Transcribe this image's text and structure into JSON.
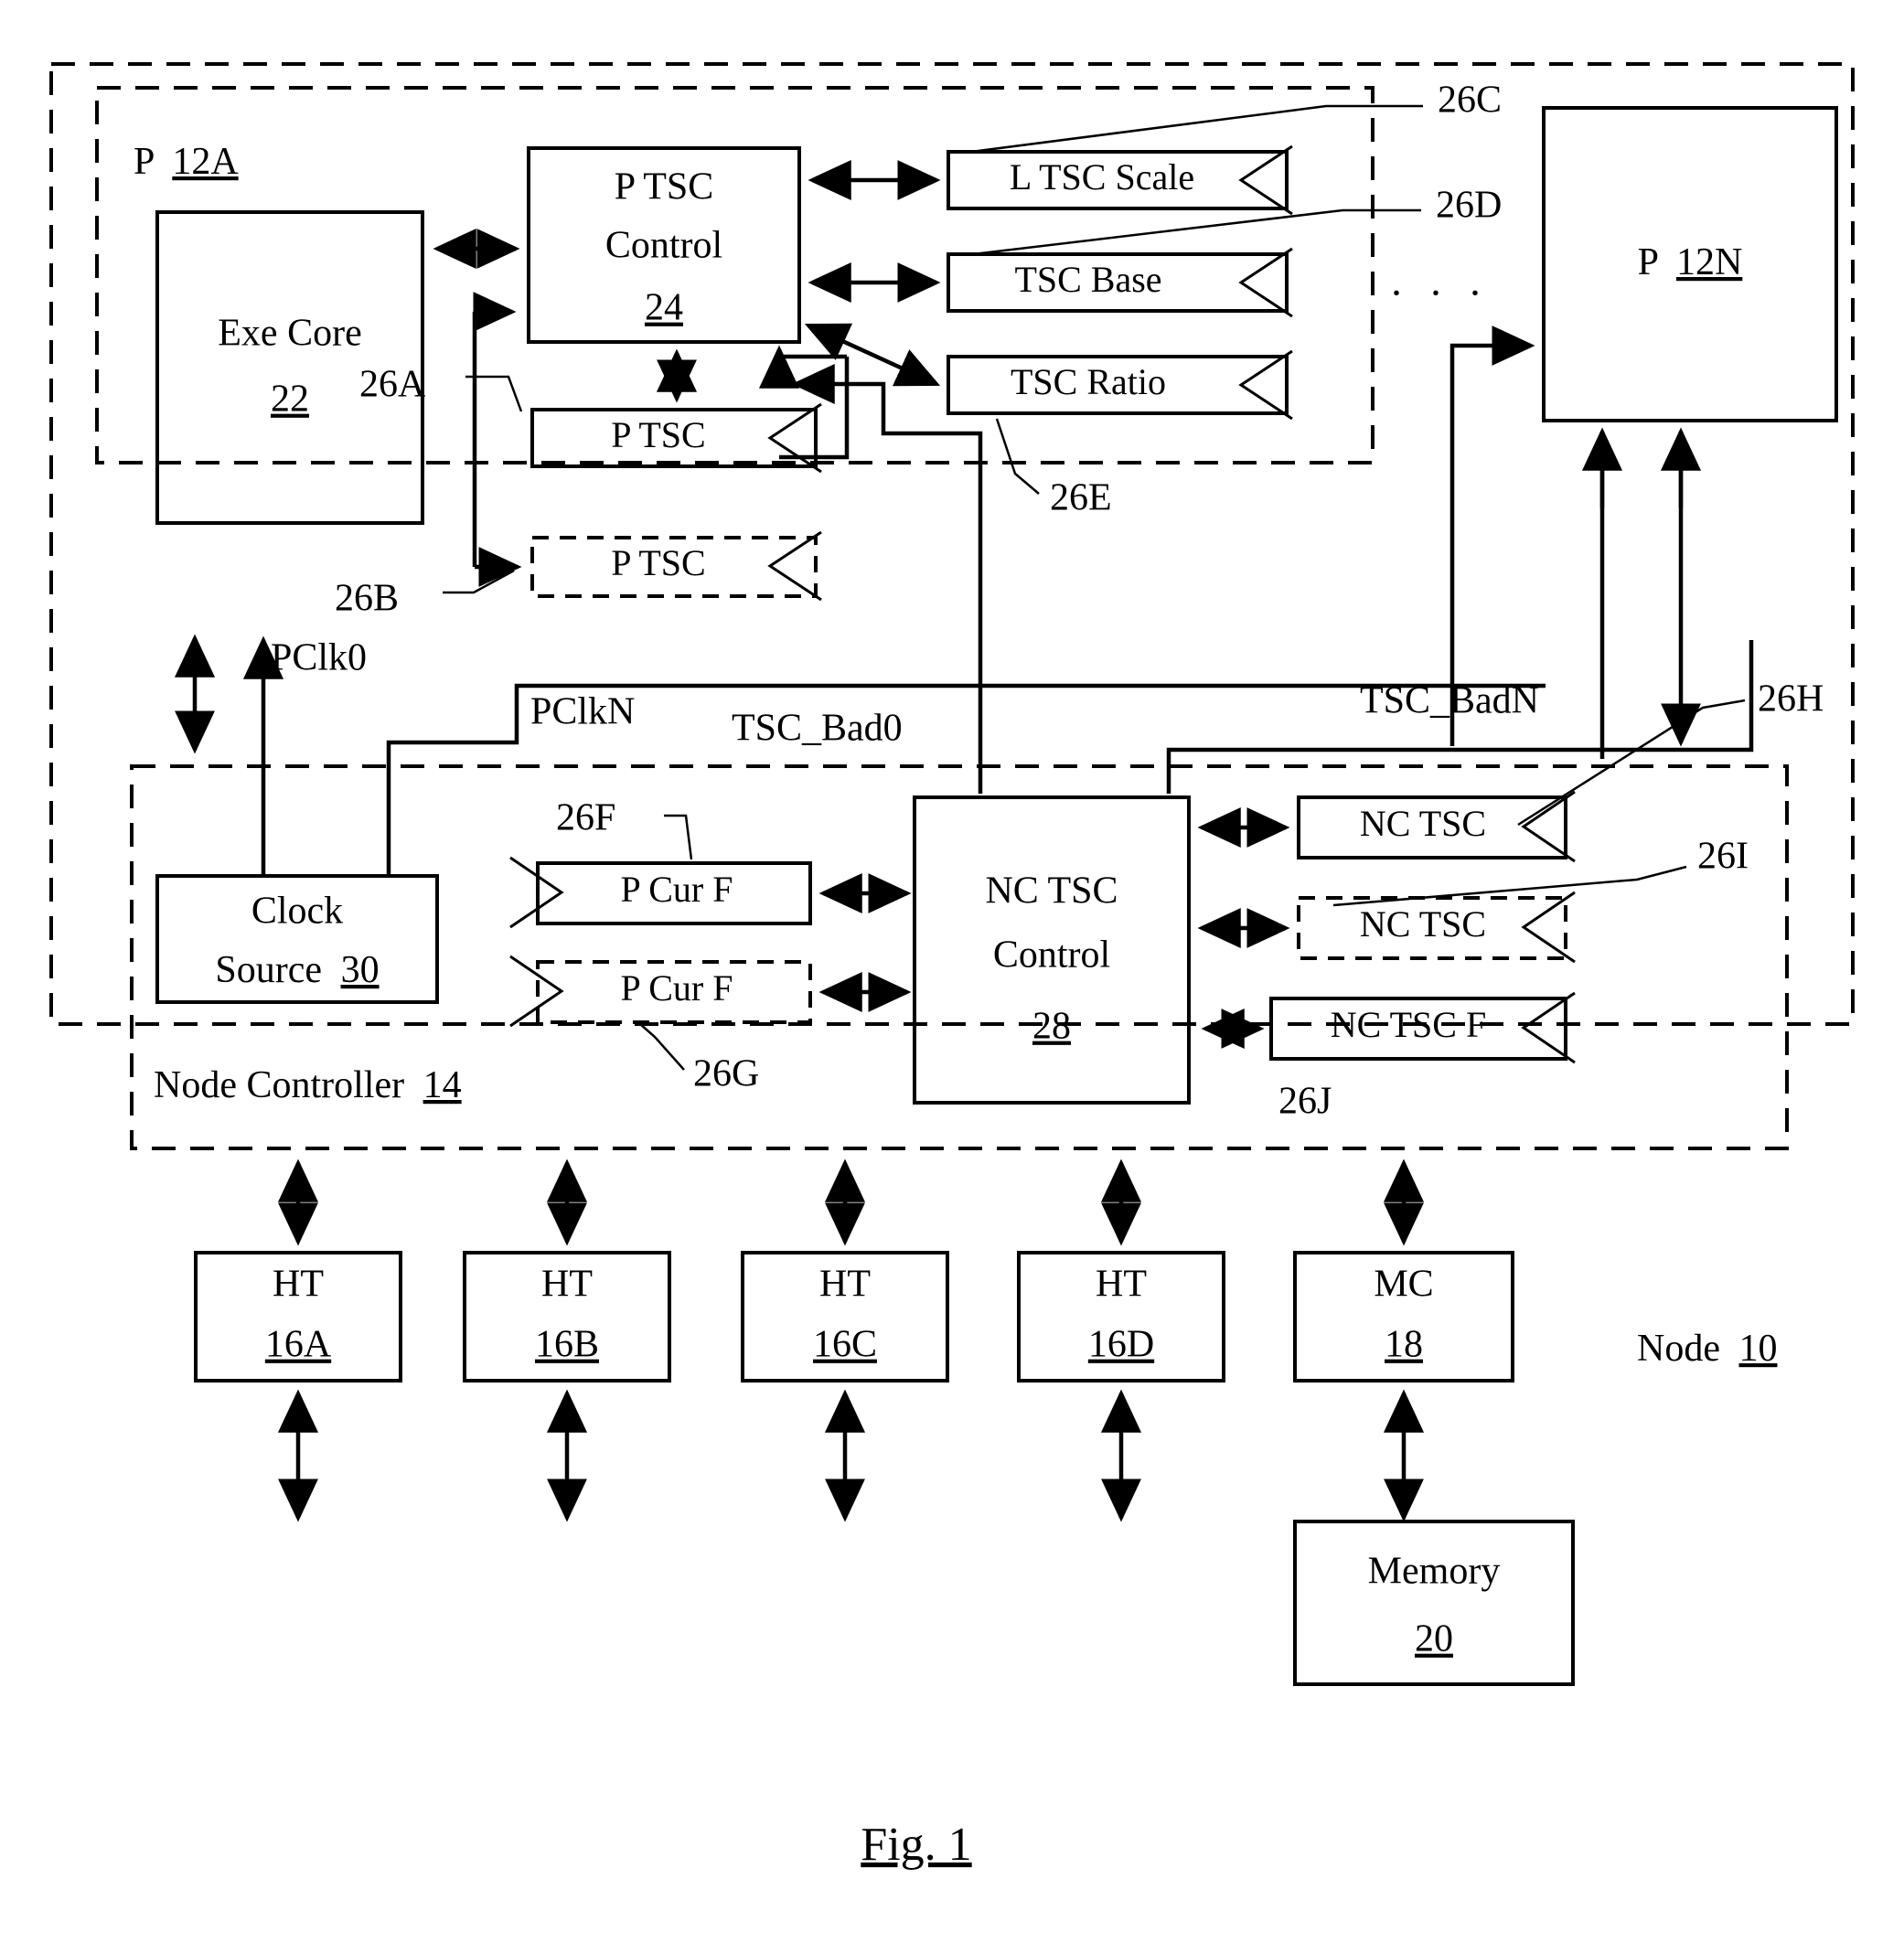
{
  "figure": {
    "caption": "Fig. 1"
  },
  "regions": {
    "node": {
      "label": "Node",
      "ref": "10"
    },
    "processor": {
      "label": "P",
      "ref": "12A"
    },
    "node_controller": {
      "label": "Node Controller",
      "ref": "14"
    }
  },
  "blocks": {
    "exe_core": {
      "line1": "Exe Core",
      "ref": "22"
    },
    "p_tsc_control": {
      "line1": "P TSC",
      "line2": "Control",
      "ref": "24"
    },
    "l_tsc_scale": {
      "label": "L TSC Scale"
    },
    "tsc_base": {
      "label": "TSC Base"
    },
    "tsc_ratio": {
      "label": "TSC Ratio"
    },
    "p_tsc_solid": {
      "label": "P TSC"
    },
    "p_tsc_dashed": {
      "label": "P TSC"
    },
    "p_12n": {
      "line1": "P",
      "ref": "12N"
    },
    "clock_source": {
      "line1": "Clock",
      "line2": "Source",
      "ref": "30"
    },
    "p_cur_f_solid": {
      "label": "P Cur F"
    },
    "p_cur_f_dashed": {
      "label": "P Cur F"
    },
    "nc_tsc_control": {
      "line1": "NC TSC",
      "line2": "Control",
      "ref": "28"
    },
    "nc_tsc_solid": {
      "label": "NC TSC"
    },
    "nc_tsc_dashed": {
      "label": "NC TSC"
    },
    "nc_tsc_f": {
      "label": "NC TSC F"
    },
    "ht_a": {
      "line1": "HT",
      "ref": "16A"
    },
    "ht_b": {
      "line1": "HT",
      "ref": "16B"
    },
    "ht_c": {
      "line1": "HT",
      "ref": "16C"
    },
    "ht_d": {
      "line1": "HT",
      "ref": "16D"
    },
    "mc": {
      "line1": "MC",
      "ref": "18"
    },
    "memory": {
      "line1": "Memory",
      "ref": "20"
    }
  },
  "reference_numerals": {
    "n26a": "26A",
    "n26b": "26B",
    "n26c": "26C",
    "n26d": "26D",
    "n26e": "26E",
    "n26f": "26F",
    "n26g": "26G",
    "n26h": "26H",
    "n26i": "26I",
    "n26j": "26J"
  },
  "signals": {
    "pclk0": "PClk0",
    "pclkn": "PClkN",
    "tsc_bad0": "TSC_Bad0",
    "tsc_badn": "TSC_BadN"
  },
  "ellipsis": ". . ."
}
